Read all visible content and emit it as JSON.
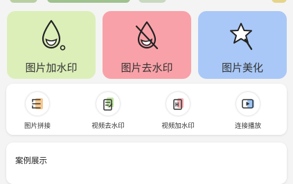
{
  "feature_tiles": [
    {
      "label": "图片加水印",
      "color": "#dcefb9",
      "icon": "water-drop-icon"
    },
    {
      "label": "图片去水印",
      "color": "#f9a1a8",
      "icon": "no-water-drop-icon"
    },
    {
      "label": "图片美化",
      "color": "#a9c8f7",
      "icon": "magic-wand-icon"
    }
  ],
  "tools": [
    {
      "label": "图片拼接",
      "icon": "collage-icon",
      "accent": "#f6c890"
    },
    {
      "label": "视频去水印",
      "icon": "video-clean-icon",
      "accent": "#bde3a0"
    },
    {
      "label": "视频加水印",
      "icon": "video-watermark-icon",
      "accent": "#f4b0b4"
    },
    {
      "label": "连接播放",
      "icon": "play-link-icon",
      "accent": "#9ec5f2"
    }
  ],
  "case_section": {
    "title": "案例展示"
  }
}
